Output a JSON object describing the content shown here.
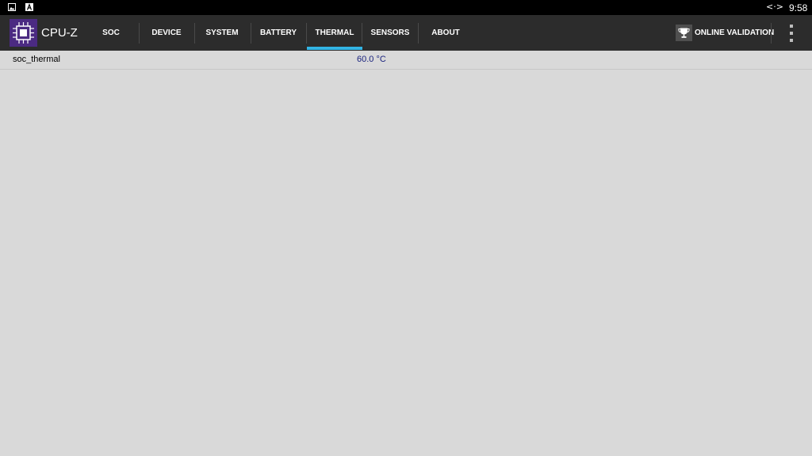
{
  "status_bar": {
    "icons": [
      "gallery-icon",
      "a-icon",
      "network-icon"
    ],
    "network_glyph": "<·>",
    "time": "9:58"
  },
  "app": {
    "title": "CPU-Z",
    "logo_icon": "cpu-chip-icon"
  },
  "tabs": [
    {
      "label": "SOC",
      "active": false
    },
    {
      "label": "DEVICE",
      "active": false
    },
    {
      "label": "SYSTEM",
      "active": false
    },
    {
      "label": "BATTERY",
      "active": false
    },
    {
      "label": "THERMAL",
      "active": true
    },
    {
      "label": "SENSORS",
      "active": false
    },
    {
      "label": "ABOUT",
      "active": false
    }
  ],
  "actions": {
    "validation_label": "ONLINE VALIDATION",
    "validation_icon": "trophy-icon",
    "menu_icon": "overflow-menu-icon"
  },
  "thermal": {
    "rows": [
      {
        "label": "soc_thermal",
        "value": "60.0 °C"
      }
    ]
  },
  "colors": {
    "accent": "#33b5e5",
    "appbar": "#2c2c2c",
    "background": "#d9d9d9",
    "value_text": "#1a237e",
    "logo": "#4b2a82"
  }
}
